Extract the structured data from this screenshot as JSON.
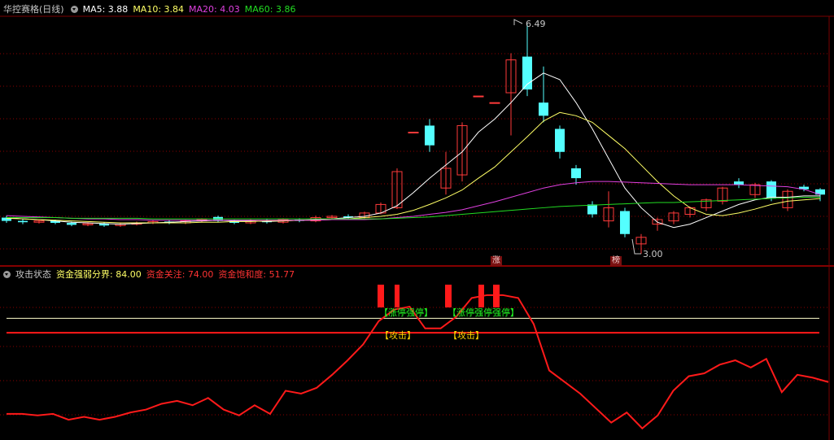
{
  "top_header": {
    "title": "华控赛格(日线)",
    "ma5": "MA5: 3.88",
    "ma10": "MA10: 3.84",
    "ma20": "MA20: 4.03",
    "ma60": "MA60: 3.86"
  },
  "bottom_header": {
    "title": "攻击状态",
    "strength": "资金强弱分界: 84.00",
    "focus": "资金关注: 74.00",
    "saturation": "资金饱和度: 51.77"
  },
  "annotations": {
    "high_label": "6.49",
    "low_label": "3.00",
    "tag_zhang": "涨",
    "tag_bang": "榜",
    "signal_a": "【涨停强停】",
    "signal_b": "【涨停强停强停】",
    "attack_a": "【攻击】",
    "attack_b": "【攻击】"
  },
  "colors": {
    "up": "#ff3a3a",
    "down": "#54ffff",
    "ma5": "#ffffff",
    "ma10": "#ffff66",
    "ma20": "#e040e0",
    "ma60": "#22dd22",
    "grid": "#8b0000",
    "capital": "#ff1a1a",
    "signal": "#22ff22",
    "attack": "#ffd700"
  },
  "chart_data": {
    "type": "candlestick",
    "price_axis": [
      3.0,
      6.49
    ],
    "candles": [
      [
        3.55,
        3.5,
        3.58,
        3.47
      ],
      [
        3.5,
        3.48,
        3.53,
        3.45
      ],
      [
        3.48,
        3.5,
        3.52,
        3.46
      ],
      [
        3.5,
        3.47,
        3.52,
        3.45
      ],
      [
        3.47,
        3.44,
        3.49,
        3.42
      ],
      [
        3.44,
        3.46,
        3.48,
        3.42
      ],
      [
        3.46,
        3.43,
        3.48,
        3.41
      ],
      [
        3.43,
        3.45,
        3.47,
        3.41
      ],
      [
        3.45,
        3.47,
        3.49,
        3.43
      ],
      [
        3.47,
        3.49,
        3.51,
        3.45
      ],
      [
        3.49,
        3.47,
        3.51,
        3.45
      ],
      [
        3.47,
        3.5,
        3.52,
        3.45
      ],
      [
        3.5,
        3.52,
        3.54,
        3.48
      ],
      [
        3.56,
        3.5,
        3.58,
        3.48
      ],
      [
        3.5,
        3.47,
        3.52,
        3.45
      ],
      [
        3.47,
        3.5,
        3.53,
        3.45
      ],
      [
        3.5,
        3.48,
        3.53,
        3.46
      ],
      [
        3.48,
        3.52,
        3.54,
        3.46
      ],
      [
        3.52,
        3.5,
        3.54,
        3.48
      ],
      [
        3.5,
        3.55,
        3.58,
        3.48
      ],
      [
        3.55,
        3.57,
        3.59,
        3.53
      ],
      [
        3.57,
        3.55,
        3.6,
        3.53
      ],
      [
        3.55,
        3.62,
        3.64,
        3.53
      ],
      [
        3.62,
        3.75,
        3.78,
        3.6
      ],
      [
        3.7,
        4.25,
        4.3,
        3.68
      ],
      [
        4.85,
        4.85,
        4.85,
        4.85
      ],
      [
        4.95,
        4.65,
        5.05,
        4.55
      ],
      [
        4.0,
        4.3,
        4.55,
        3.9
      ],
      [
        4.2,
        4.95,
        5.0,
        4.1
      ],
      [
        5.4,
        5.4,
        5.4,
        5.4
      ],
      [
        5.3,
        5.3,
        5.3,
        5.3
      ],
      [
        5.45,
        5.95,
        6.05,
        4.8
      ],
      [
        6.0,
        5.5,
        6.49,
        5.4
      ],
      [
        5.3,
        5.1,
        5.85,
        5.0
      ],
      [
        4.9,
        4.55,
        4.95,
        4.45
      ],
      [
        4.3,
        4.15,
        4.35,
        4.05
      ],
      [
        3.75,
        3.6,
        3.8,
        3.55
      ],
      [
        3.5,
        3.7,
        3.95,
        3.4
      ],
      [
        3.65,
        3.3,
        3.7,
        3.25
      ],
      [
        3.15,
        3.25,
        3.3,
        3.0
      ],
      [
        3.45,
        3.52,
        3.55,
        3.35
      ],
      [
        3.5,
        3.62,
        3.65,
        3.45
      ],
      [
        3.6,
        3.7,
        3.72,
        3.55
      ],
      [
        3.7,
        3.82,
        3.84,
        3.65
      ],
      [
        3.8,
        4.0,
        4.02,
        3.75
      ],
      [
        4.1,
        4.05,
        4.15,
        4.0
      ],
      [
        3.9,
        4.05,
        4.08,
        3.85
      ],
      [
        4.1,
        3.85,
        4.12,
        3.8
      ],
      [
        3.7,
        3.95,
        3.98,
        3.65
      ],
      [
        4.02,
        3.98,
        4.05,
        3.95
      ],
      [
        3.98,
        3.9,
        4.0,
        3.8
      ]
    ],
    "ma_series": [
      {
        "name": "MA5",
        "values": [
          3.55,
          3.53,
          3.52,
          3.5,
          3.48,
          3.47,
          3.46,
          3.45,
          3.46,
          3.47,
          3.48,
          3.49,
          3.5,
          3.51,
          3.5,
          3.5,
          3.49,
          3.5,
          3.51,
          3.52,
          3.53,
          3.55,
          3.57,
          3.62,
          3.73,
          3.93,
          4.15,
          4.35,
          4.55,
          4.85,
          5.05,
          5.3,
          5.58,
          5.75,
          5.65,
          5.3,
          4.9,
          4.45,
          4.0,
          3.7,
          3.48,
          3.4,
          3.45,
          3.55,
          3.65,
          3.75,
          3.82,
          3.86,
          3.86,
          3.88,
          3.88
        ]
      },
      {
        "name": "MA10",
        "values": [
          3.54,
          3.53,
          3.52,
          3.51,
          3.5,
          3.49,
          3.48,
          3.47,
          3.47,
          3.47,
          3.47,
          3.47,
          3.48,
          3.48,
          3.49,
          3.49,
          3.5,
          3.5,
          3.51,
          3.51,
          3.52,
          3.53,
          3.55,
          3.57,
          3.6,
          3.66,
          3.75,
          3.85,
          3.97,
          4.15,
          4.32,
          4.55,
          4.78,
          5.02,
          5.15,
          5.1,
          5.0,
          4.8,
          4.6,
          4.35,
          4.1,
          3.88,
          3.7,
          3.6,
          3.58,
          3.62,
          3.68,
          3.75,
          3.8,
          3.82,
          3.84
        ]
      },
      {
        "name": "MA20",
        "values": [
          3.58,
          3.57,
          3.56,
          3.55,
          3.54,
          3.53,
          3.53,
          3.52,
          3.52,
          3.51,
          3.51,
          3.51,
          3.51,
          3.51,
          3.51,
          3.51,
          3.51,
          3.51,
          3.51,
          3.51,
          3.52,
          3.52,
          3.52,
          3.53,
          3.55,
          3.57,
          3.6,
          3.63,
          3.67,
          3.73,
          3.79,
          3.86,
          3.93,
          4.0,
          4.05,
          4.08,
          4.1,
          4.1,
          4.09,
          4.08,
          4.07,
          4.06,
          4.05,
          4.05,
          4.05,
          4.05,
          4.04,
          4.03,
          4.02,
          3.98,
          3.9
        ]
      },
      {
        "name": "MA60",
        "values": [
          3.55,
          3.55,
          3.55,
          3.55,
          3.54,
          3.54,
          3.54,
          3.54,
          3.54,
          3.53,
          3.53,
          3.53,
          3.53,
          3.53,
          3.53,
          3.53,
          3.53,
          3.53,
          3.53,
          3.53,
          3.53,
          3.53,
          3.53,
          3.53,
          3.54,
          3.55,
          3.56,
          3.58,
          3.6,
          3.62,
          3.64,
          3.66,
          3.68,
          3.7,
          3.72,
          3.73,
          3.74,
          3.75,
          3.76,
          3.77,
          3.78,
          3.78,
          3.79,
          3.8,
          3.81,
          3.82,
          3.83,
          3.84,
          3.85,
          3.86,
          3.86
        ]
      }
    ],
    "capital_line": {
      "name": "资金",
      "range": [
        0,
        110
      ],
      "values": [
        18,
        18,
        17,
        18,
        14,
        16,
        14,
        16,
        19,
        21,
        25,
        27,
        24,
        29,
        21,
        17,
        24,
        18,
        34,
        32,
        36,
        45,
        55,
        66,
        82,
        90,
        92,
        77,
        77,
        85,
        98,
        100,
        100,
        98,
        80,
        48,
        40,
        32,
        22,
        12,
        19,
        8,
        17,
        34,
        44,
        46,
        52,
        55,
        50,
        56,
        33,
        45,
        43,
        40
      ]
    },
    "strength_threshold": 84.0,
    "focus_threshold": 74.0,
    "saturation": 51.77
  }
}
